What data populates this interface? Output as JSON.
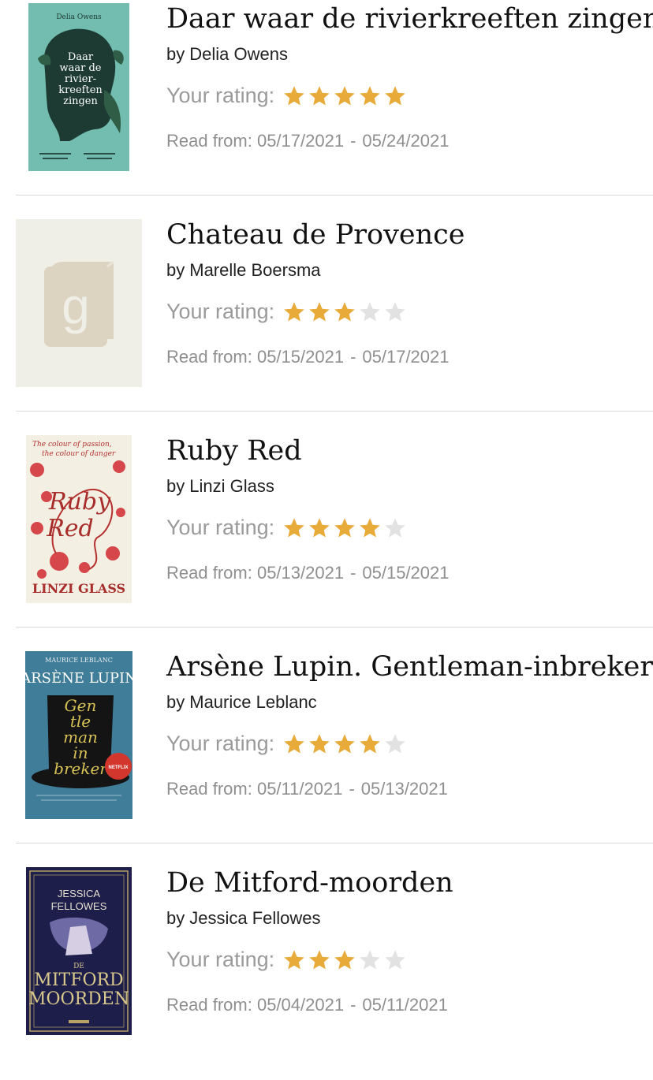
{
  "colors": {
    "star_filled": "#e8ab3a",
    "star_empty": "#e2e2e2",
    "divider": "#d9d9d9"
  },
  "labels": {
    "by": "by",
    "your_rating": "Your rating:",
    "read_from": "Read from:",
    "date_sep": "-"
  },
  "books": [
    {
      "title": "Daar waar de rivierkreeften zingen",
      "author": "Delia Owens",
      "rating": 5,
      "read_start": "05/17/2021",
      "read_end": "05/24/2021",
      "cover": {
        "author_line": "Delia Owens",
        "title_lines": [
          "Daar",
          "waar de",
          "rivier-",
          "kreeften",
          "zingen"
        ]
      }
    },
    {
      "title": "Chateau de Provence",
      "author": "Marelle Boersma",
      "rating": 3,
      "read_start": "05/15/2021",
      "read_end": "05/17/2021",
      "cover": {
        "placeholder_glyph": "g"
      }
    },
    {
      "title": "Ruby Red",
      "author": "Linzi Glass",
      "rating": 4,
      "read_start": "05/13/2021",
      "read_end": "05/15/2021",
      "cover": {
        "tagline": [
          "The colour of passion,",
          "the colour of danger"
        ],
        "title_lines": [
          "Ruby",
          "Red"
        ],
        "author_line": "LINZI GLASS"
      }
    },
    {
      "title": "Arsène Lupin. Gentleman-inbreker",
      "author": "Maurice Leblanc",
      "rating": 4,
      "read_start": "05/11/2021",
      "read_end": "05/13/2021",
      "cover": {
        "author_line": "MAURICE LEBLANC",
        "series_line": "ARSÈNE LUPIN",
        "title_lines": [
          "Gen",
          "tle",
          "man",
          "in",
          "breker"
        ],
        "badge": "NETFLIX"
      }
    },
    {
      "title": "De Mitford-moorden",
      "author": "Jessica Fellowes",
      "rating": 3,
      "read_start": "05/04/2021",
      "read_end": "05/11/2021",
      "cover": {
        "author_lines": [
          "JESSICA",
          "FELLOWES"
        ],
        "title_lines": [
          "DE",
          "MITFORD",
          "MOORDEN"
        ]
      }
    }
  ]
}
